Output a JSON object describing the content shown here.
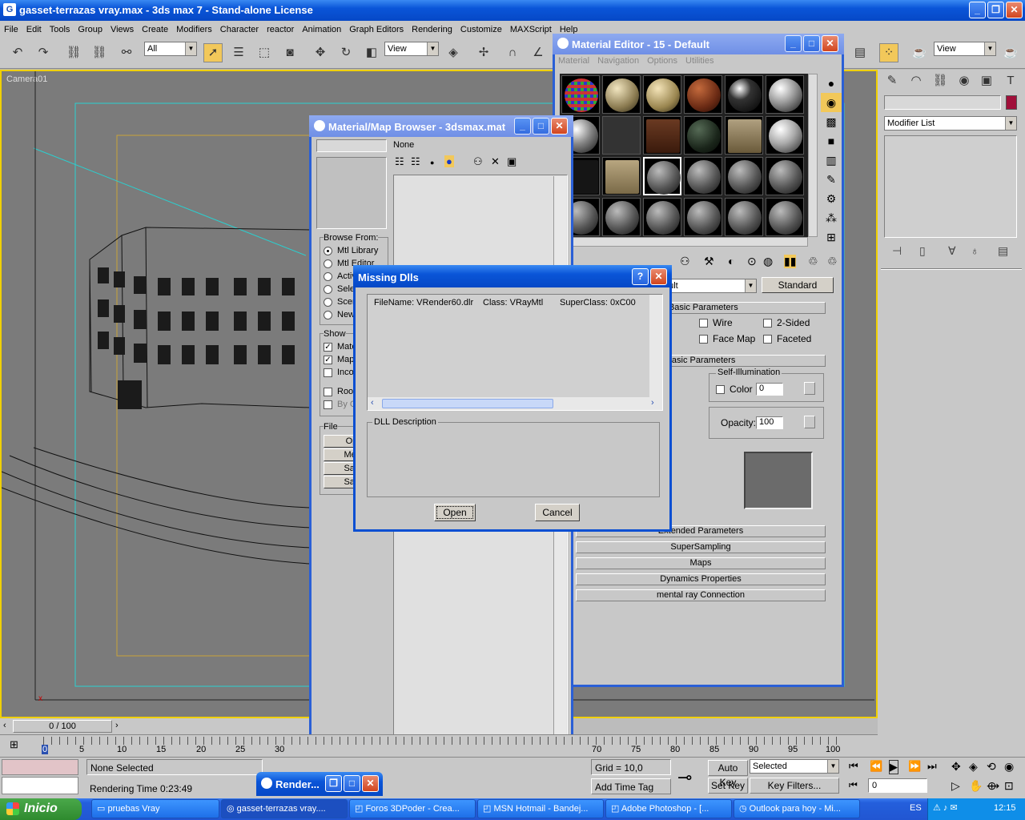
{
  "app": {
    "title": "gasset-terrazas vray.max - 3ds max 7  - Stand-alone License",
    "menu": [
      "File",
      "Edit",
      "Tools",
      "Group",
      "Views",
      "Create",
      "Modifiers",
      "Character",
      "reactor",
      "Animation",
      "Graph Editors",
      "Rendering",
      "Customize",
      "MAXScript",
      "Help"
    ],
    "toolbar": {
      "selection_filter": "All",
      "ref_coord": "View",
      "ref_coord_right": "View"
    }
  },
  "viewport": {
    "label": "Camera01"
  },
  "command_panel": {
    "modifier_list": "Modifier List",
    "color_swatch": "#a0103a"
  },
  "material_editor": {
    "title": "Material Editor - 15 - Default",
    "menu": [
      "Material",
      "Navigation",
      "Options",
      "Utilities"
    ],
    "mat_name_tail": "ault",
    "type_button": "Standard",
    "rollouts": {
      "shader_basic": "r Basic Parameters",
      "wire": "Wire",
      "two_sided": "2-Sided",
      "face_map": "Face Map",
      "faceted": "Faceted",
      "basic_params": "Basic Parameters",
      "self_illum": "Self-Illumination",
      "color": "Color",
      "color_value": "0",
      "opacity": "Opacity:",
      "opacity_value": "100",
      "extended": "Extended Parameters",
      "supersampling": "SuperSampling",
      "maps": "Maps",
      "dynamics": "Dynamics Properties",
      "mental_ray": "mental ray Connection"
    }
  },
  "browser": {
    "title": "Material/Map Browser - 3dsmax.mat",
    "none_label": "None",
    "browse_from": "Browse From:",
    "browse_options": [
      "Mtl Library",
      "Mtl Editor",
      "Activ",
      "Sele",
      "Scen",
      "New"
    ],
    "show": "Show",
    "show_options": [
      "Mate",
      "Map",
      "Inco"
    ],
    "root": "Roo",
    "byobj": "By O",
    "file": "File",
    "file_buttons": [
      "Ope",
      "Merg",
      "Save",
      "Save"
    ]
  },
  "dialog": {
    "title": "Missing Dlls",
    "filename": "FileName:  VRender60.dlr",
    "class": "Class: VRayMtl",
    "superclass": "SuperClass: 0xC00",
    "dll_desc": "DLL Description",
    "open": "Open",
    "cancel": "Cancel"
  },
  "render_window": {
    "title": "Render..."
  },
  "timeline": {
    "frame": "0 / 100",
    "ticks": [
      "0",
      "5",
      "10",
      "15",
      "20",
      "25",
      "30",
      "70",
      "75",
      "80",
      "85",
      "90",
      "95",
      "100"
    ]
  },
  "status": {
    "none_selected": "None Selected",
    "render_time": "Rendering Time  0:23:49",
    "grid": "Grid = 10,0",
    "add_time_tag": "Add Time Tag",
    "auto_key": "Auto Key",
    "set_key": "Set Key",
    "selected": "Selected",
    "key_filters": "Key Filters...",
    "frame_value": "0"
  },
  "taskbar": {
    "start": "Inicio",
    "items": [
      "pruebas Vray",
      "gasset-terrazas vray....",
      "Foros 3DPoder - Crea...",
      "MSN Hotmail - Bandej...",
      "Adobe Photoshop - [...",
      "Outlook para hoy - Mi..."
    ],
    "lang": "ES",
    "clock": "12:15"
  }
}
